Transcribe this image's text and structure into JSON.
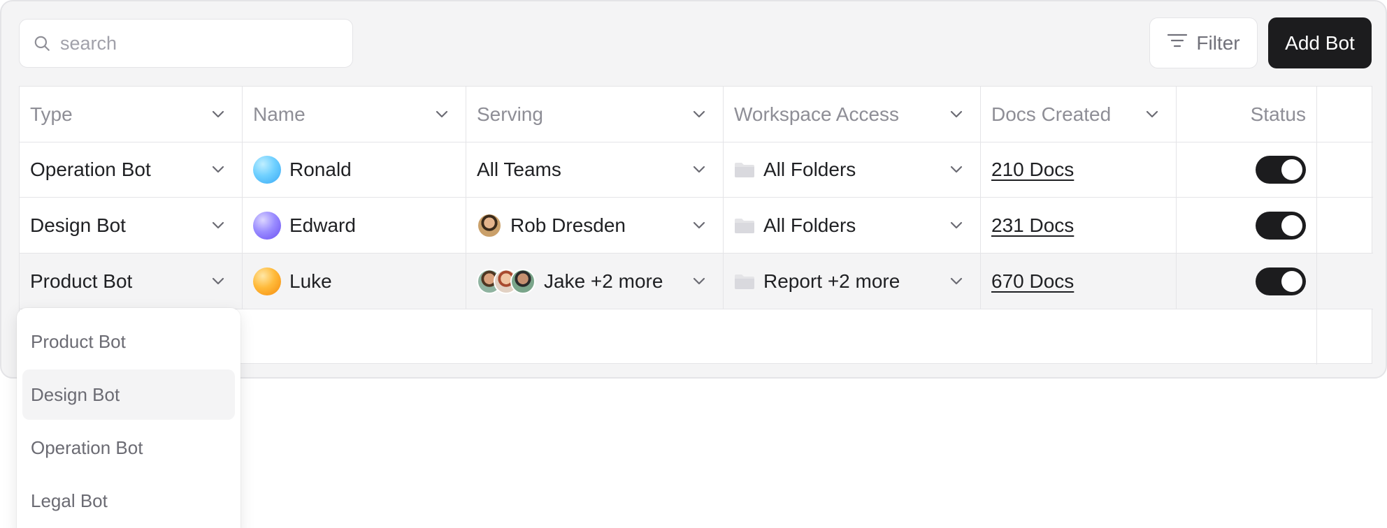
{
  "toolbar": {
    "search_placeholder": "search",
    "search_value": "",
    "filter_label": "Filter",
    "add_label": "Add Bot",
    "search_icon": "search-icon",
    "filter_icon": "filter-icon"
  },
  "table": {
    "columns": [
      "Type",
      "Name",
      "Serving",
      "Workspace Access",
      "Docs Created",
      "Status"
    ],
    "rows": [
      {
        "type": "Operation Bot",
        "name": "Ronald",
        "name_icon": "blue-orb-avatar",
        "serving": "All Teams",
        "workspace": "All Folders",
        "docs": "210 Docs",
        "status_on": true
      },
      {
        "type": "Design Bot",
        "name": "Edward",
        "name_icon": "purple-orb-avatar",
        "serving": "Rob Dresden",
        "workspace": "All Folders",
        "docs": "231 Docs",
        "status_on": true
      },
      {
        "type": "Product Bot",
        "name": "Luke",
        "name_icon": "orange-orb-avatar",
        "serving": "Jake +2 more",
        "workspace": "Report +2 more",
        "docs": "670 Docs",
        "status_on": true
      }
    ]
  },
  "type_dropdown": {
    "options": [
      "Product Bot",
      "Design Bot",
      "Operation Bot",
      "Legal Bot"
    ],
    "highlighted": "Design Bot"
  },
  "colors": {
    "panel_bg": "#f4f4f5",
    "border": "#e4e4e7",
    "primary_dark": "#1c1c1e",
    "muted_text": "#8e8e96"
  }
}
